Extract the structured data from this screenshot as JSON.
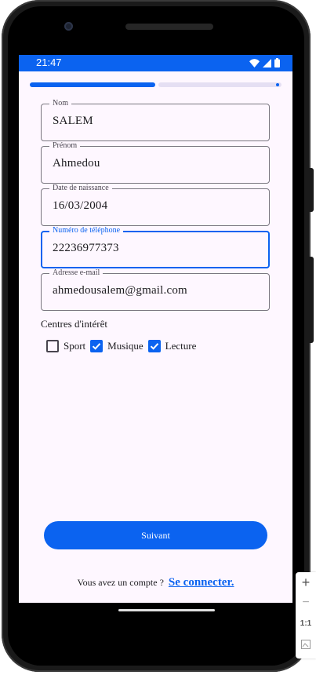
{
  "status": {
    "time": "21:47"
  },
  "progress": {
    "percent": 51
  },
  "fields": {
    "nom": {
      "label": "Nom",
      "value": "SALEM"
    },
    "prenom": {
      "label": "Prénom",
      "value": "Ahmedou"
    },
    "naissance": {
      "label": "Date de naissance",
      "value": "16/03/2004"
    },
    "telephone": {
      "label": "Numéro de téléphone",
      "value": "22236977373"
    },
    "email": {
      "label": "Adresse e-mail",
      "value": "ahmedousalem@gmail.com"
    }
  },
  "interests": {
    "title": "Centres d'intérêt",
    "items": [
      {
        "label": "Sport",
        "checked": false
      },
      {
        "label": "Musique",
        "checked": true
      },
      {
        "label": "Lecture",
        "checked": true
      }
    ]
  },
  "next_label": "Suivant",
  "footer": {
    "prompt": "Vous avez un compte ?",
    "link": "Se connecter."
  },
  "zoom_panel": {
    "plus": "+",
    "minus": "−",
    "ratio": "1:1"
  },
  "colors": {
    "primary": "#0b63f0",
    "background": "#fef7ff"
  }
}
